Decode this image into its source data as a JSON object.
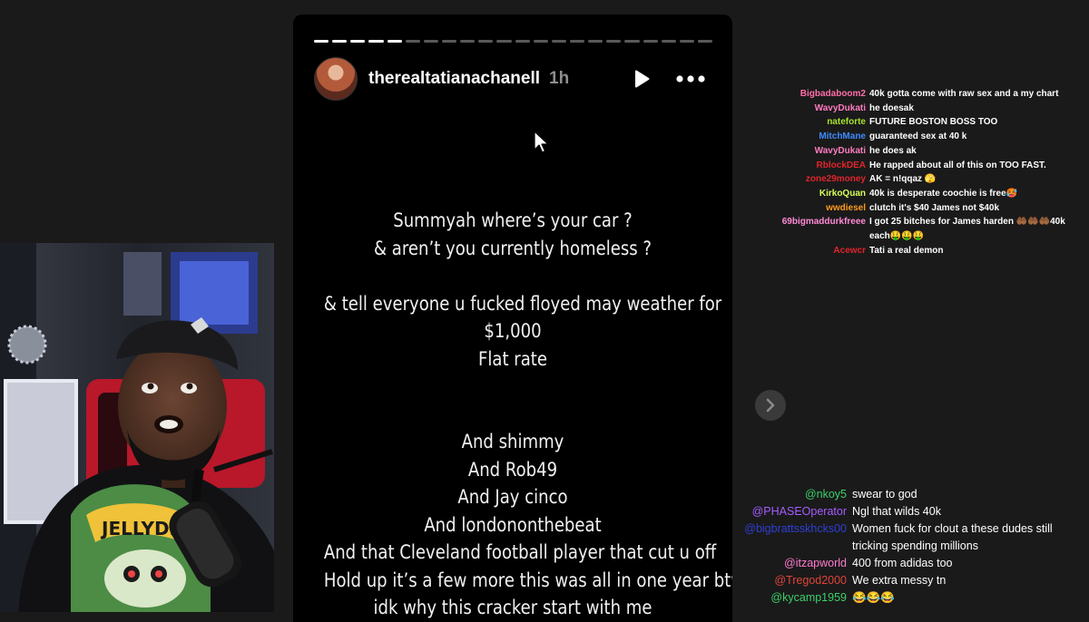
{
  "story": {
    "progress": {
      "total": 22,
      "completed": 5
    },
    "username": "therealtatianachanell",
    "time_ago": "1h",
    "lines": [
      "Summyah where’s your car ?",
      "& aren’t you currently homeless ?",
      "",
      "& tell everyone u fucked floyed may weather for",
      "$1,000",
      "Flat rate",
      "",
      "",
      "And shimmy",
      "And Rob49",
      "And Jay cinco",
      "And londononthebeat",
      "And that Cleveland football player that cut u off",
      "Hold up it’s a few more this was all in one year btw",
      "idk why this cracker start with me"
    ]
  },
  "chat_top": [
    {
      "user": "Bigbadaboom2",
      "color": "#ff6fa8",
      "text": "40k gotta come with raw sex and a my chart"
    },
    {
      "user": "WavyDukati",
      "color": "#ff7cc0",
      "text": "he doesak"
    },
    {
      "user": "nateforte",
      "color": "#a6e22e",
      "text": "FUTURE BOSTON BOSS TOO"
    },
    {
      "user": "MitchMane",
      "color": "#3d8bff",
      "text": "guaranteed sex at 40 k"
    },
    {
      "user": "WavyDukati",
      "color": "#ff7cc0",
      "text": "he does ak"
    },
    {
      "user": "RblockDEA",
      "color": "#e0252b",
      "text": "He rapped about all of this on TOO FAST."
    },
    {
      "user": "zone29money",
      "color": "#e0252b",
      "text": "AK = n!qqaz 🫣"
    },
    {
      "user": "KirkoQuan",
      "color": "#d6ff5a",
      "text": "40k is desperate coochie is free🥵"
    },
    {
      "user": "wwdiesel",
      "color": "#ff9a1f",
      "text": "clutch it's $40 James not $40k"
    },
    {
      "user": "69bigmaddurkfreee",
      "color": "#ff8ad8",
      "text": "I got 25 bitches for James harden 🤲🏾🤲🏾🤲🏾40k each🤑🤑🤑"
    },
    {
      "user": "Acewcr",
      "color": "#e0252b",
      "text": "Tati a real demon"
    }
  ],
  "chat_bottom": [
    {
      "user": "@nkoy5",
      "color": "#3ad06a",
      "text": "swear to god"
    },
    {
      "user": "@PHASEOperator",
      "color": "#a55cff",
      "text": "Ngl that wilds 40k"
    },
    {
      "user": "@bigbrattsskhcks00",
      "color": "#2f3fd6",
      "text": "Women fuck for clout a these dudes still tricking spending millions"
    },
    {
      "user": "@itzapworld",
      "color": "#ff7ad0",
      "text": "400 from adidas too"
    },
    {
      "user": "@Tregod2000",
      "color": "#e0453a",
      "text": "We extra messy tn"
    },
    {
      "user": "@kycamp1959",
      "color": "#3ad06a",
      "text": "😂😂😂"
    }
  ],
  "webcam": {
    "shirt_text": "JELLYDE"
  }
}
